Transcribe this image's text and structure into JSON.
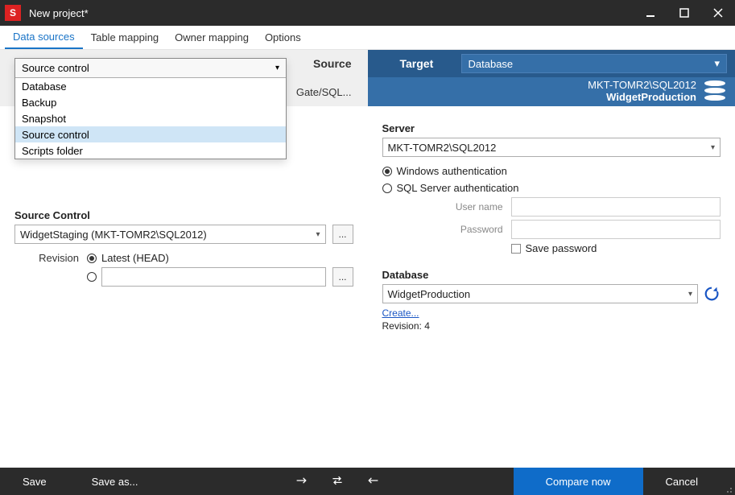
{
  "title": "New project*",
  "menubar": [
    "Data sources",
    "Table mapping",
    "Owner mapping",
    "Options"
  ],
  "active_tab_index": 0,
  "banner": {
    "source_label": "Source",
    "source_subtitle": "Gate/SQL...",
    "target_label": "Target",
    "target_selector_value": "Database",
    "target_server": "MKT-TOMR2\\SQL2012",
    "target_db": "WidgetProduction"
  },
  "dropdown": {
    "header": "Source control",
    "options": [
      "Database",
      "Backup",
      "Snapshot",
      "Source control",
      "Scripts folder"
    ],
    "selected_index": 3
  },
  "source_pane": {
    "section_label": "Source Control",
    "repo_value": "WidgetStaging (MKT-TOMR2\\SQL2012)",
    "revision_label": "Revision",
    "revision_latest_label": "Latest (HEAD)"
  },
  "target_pane": {
    "server_label": "Server",
    "server_value": "MKT-TOMR2\\SQL2012",
    "auth_windows": "Windows authentication",
    "auth_sql": "SQL Server authentication",
    "user_label": "User name",
    "password_label": "Password",
    "save_pw_label": "Save password",
    "database_label": "Database",
    "database_value": "WidgetProduction",
    "create_link": "Create...",
    "revision_text": "Revision: 4"
  },
  "footer": {
    "save": "Save",
    "save_as": "Save as...",
    "compare": "Compare now",
    "cancel": "Cancel"
  }
}
